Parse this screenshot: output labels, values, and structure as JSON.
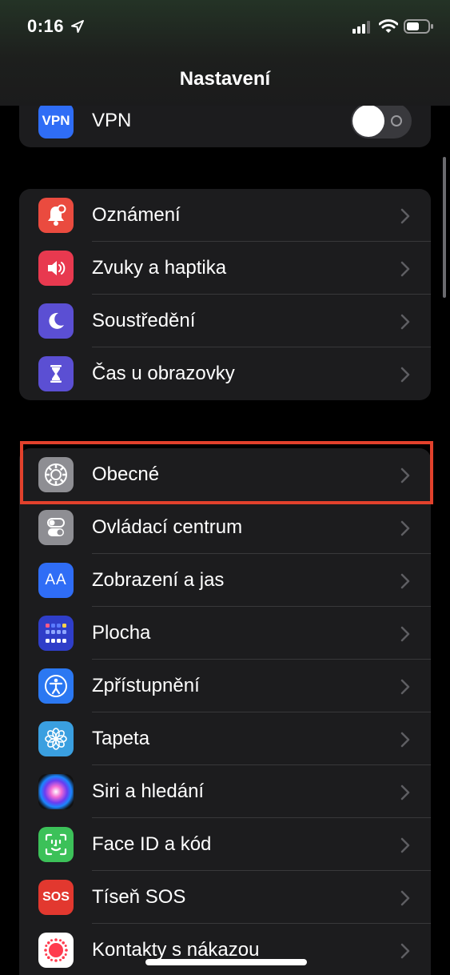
{
  "status_bar": {
    "time": "0:16"
  },
  "nav": {
    "title": "Nastavení"
  },
  "vpn": {
    "label": "VPN",
    "icon_text": "VPN",
    "icon": "vpn-icon",
    "color": "#2f6df6",
    "toggle_on": false
  },
  "group_notifications": [
    {
      "label": "Oznámení",
      "icon": "bell-icon",
      "color": "#ea4b3f"
    },
    {
      "label": "Zvuky a haptika",
      "icon": "speaker-icon",
      "color": "#e8394f"
    },
    {
      "label": "Soustředění",
      "icon": "moon-icon",
      "color": "#5b4fd3"
    },
    {
      "label": "Čas u obrazovky",
      "icon": "hourglass-icon",
      "color": "#5b4fd3"
    }
  ],
  "group_general": [
    {
      "label": "Obecné",
      "icon": "gear-icon",
      "color": "#8e8e93",
      "highlighted": true
    },
    {
      "label": "Ovládací centrum",
      "icon": "switches-icon",
      "color": "#8e8e93"
    },
    {
      "label": "Zobrazení a jas",
      "icon": "text-size-icon",
      "icon_text": "AA",
      "color": "#2f6df6"
    },
    {
      "label": "Plocha",
      "icon": "home-screen-icon",
      "color": "#2f3ec9"
    },
    {
      "label": "Zpřístupnění",
      "icon": "accessibility-icon",
      "color": "#2b78f2"
    },
    {
      "label": "Tapeta",
      "icon": "flower-icon",
      "color": "#3a9fe0"
    },
    {
      "label": "Siri a hledání",
      "icon": "siri-icon",
      "color": "#1c1c1e"
    },
    {
      "label": "Face ID a kód",
      "icon": "face-id-icon",
      "color": "#3cc159"
    },
    {
      "label": "Tíseň SOS",
      "icon": "sos-icon",
      "icon_text": "SOS",
      "color": "#e2382f"
    },
    {
      "label": "Kontakty s nákazou",
      "icon": "exposure-icon",
      "color": "#ffffff"
    }
  ]
}
